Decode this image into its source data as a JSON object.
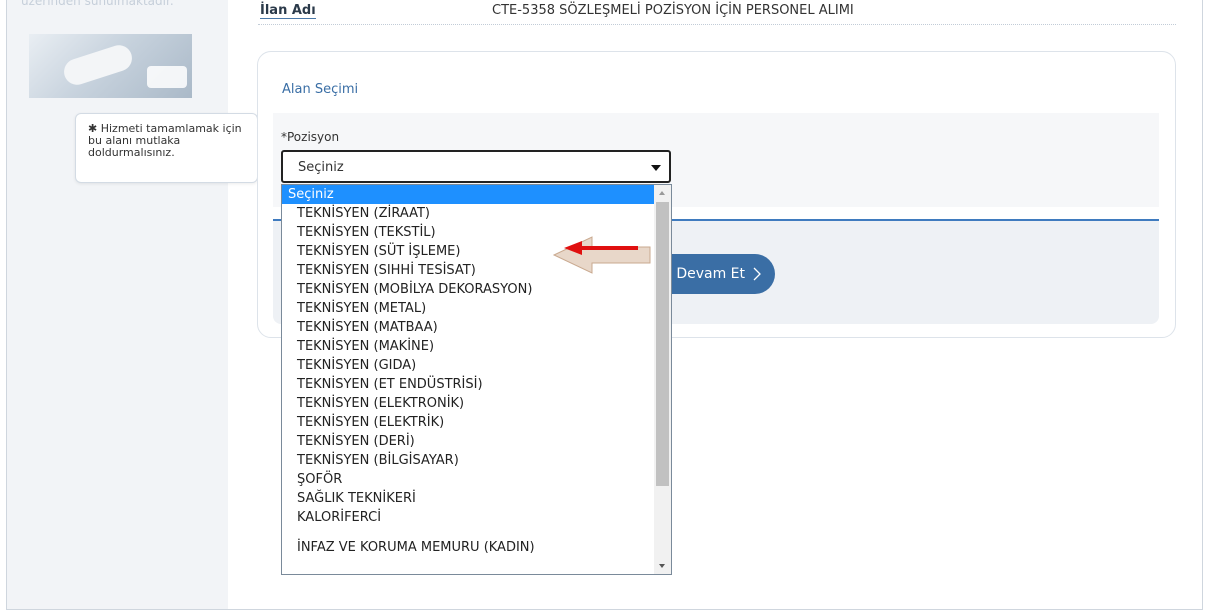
{
  "sidebar": {
    "top_text": "üzerinden sunulmaktadır.",
    "tooltip_star": "✱",
    "tooltip_text": "Hizmeti tamamlamak için bu alanı mutlaka doldurmalısınız."
  },
  "header": {
    "label": "İlan Adı",
    "value": "CTE-5358 SÖZLEŞMELİ POZİSYON İÇİN PERSONEL ALIMI"
  },
  "form": {
    "section_title": "Alan Seçimi",
    "field_label": "*Pozisyon",
    "select_value": "Seçiniz",
    "continue_label": "Devam Et",
    "continue_icon": "chevron-right-icon"
  },
  "dropdown": {
    "options": [
      "Seçiniz",
      "TEKNİSYEN (ZİRAAT)",
      "TEKNİSYEN (TEKSTİL)",
      "TEKNİSYEN (SÜT İŞLEME)",
      "TEKNİSYEN (SIHHİ TESİSAT)",
      "TEKNİSYEN (MOBİLYA DEKORASYON)",
      "TEKNİSYEN (METAL)",
      "TEKNİSYEN (MATBAA)",
      "TEKNİSYEN (MAKİNE)",
      "TEKNİSYEN (GIDA)",
      "TEKNİSYEN (ET ENDÜSTRİSİ)",
      "TEKNİSYEN (ELEKTRONİK)",
      "TEKNİSYEN (ELEKTRİK)",
      "TEKNİSYEN (DERİ)",
      "TEKNİSYEN (BİLGİSAYAR)",
      "ŞOFÖR",
      "SAĞLIK TEKNİKERİ",
      "KALORİFERCİ",
      "",
      "İNFAZ VE KORUMA MEMURU (KADIN)"
    ]
  },
  "colors": {
    "accent": "#3a6ea5",
    "selected": "#1e90ff",
    "annotation_arrow": "#e01010"
  }
}
